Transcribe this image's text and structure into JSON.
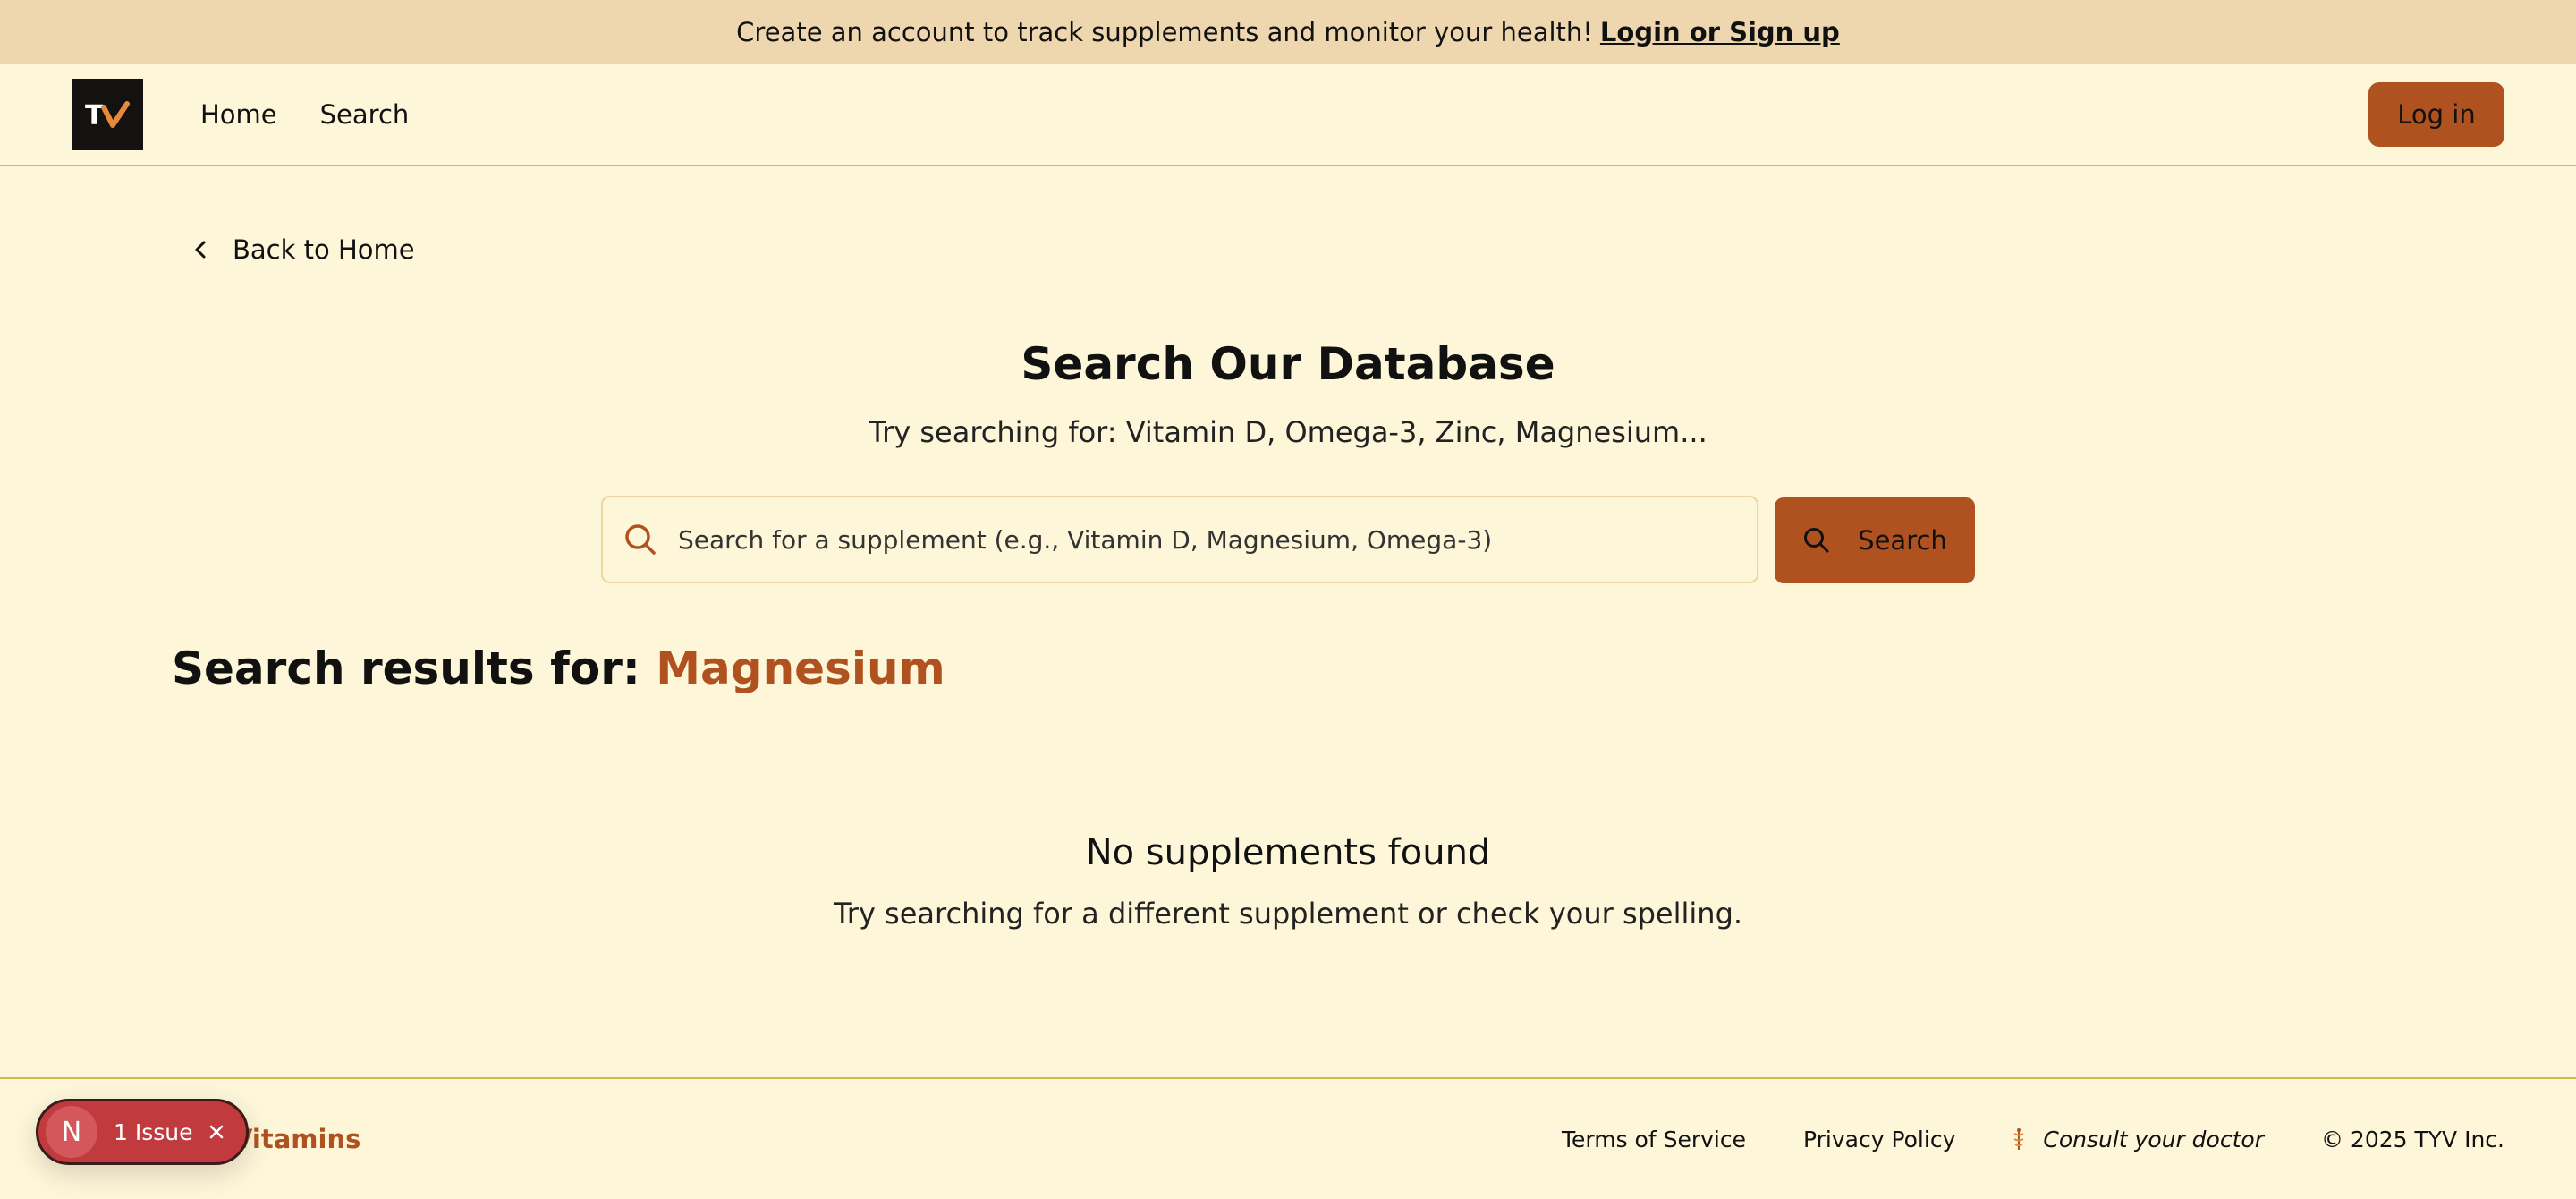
{
  "promo": {
    "text": "Create an account to track supplements and monitor your health!",
    "link": "Login or Sign up"
  },
  "nav": {
    "logo_text": "TYV",
    "links": [
      "Home",
      "Search"
    ],
    "login_label": "Log in"
  },
  "back_link": "Back to Home",
  "search": {
    "title": "Search Our Database",
    "subtitle": "Try searching for: Vitamin D, Omega-3, Zinc, Magnesium...",
    "placeholder": "Search for a supplement (e.g., Vitamin D, Magnesium, Omega-3)",
    "button_label": "Search"
  },
  "results": {
    "heading": "Search results for:",
    "term": "Magnesium",
    "empty_title": "No supplements found",
    "empty_subtitle": "Try searching for a different supplement or check your spelling."
  },
  "footer": {
    "brand": "Vitamins",
    "links": [
      "Terms of Service",
      "Privacy Policy"
    ],
    "consult": "Consult your doctor",
    "copyright": "© 2025 TYV Inc."
  },
  "dev_badge": {
    "avatar": "N",
    "label": "1 Issue"
  },
  "colors": {
    "accent": "#b0521f",
    "background": "#fdf6d8",
    "promo_bg": "#eed7ae",
    "badge": "#c03a3e"
  }
}
